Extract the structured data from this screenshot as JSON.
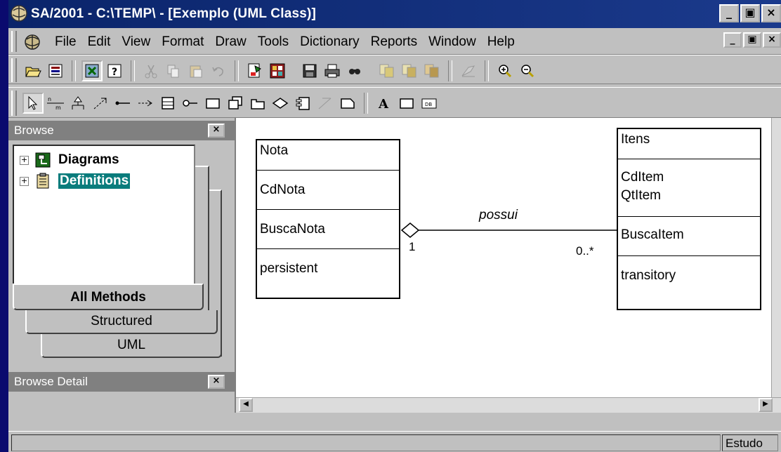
{
  "window": {
    "title": "SA/2001 - C:\\TEMP\\ - [Exemplo (UML Class)]",
    "buttons": {
      "minimize": "_",
      "restore": "▣",
      "close": "×"
    }
  },
  "menu": [
    "File",
    "Edit",
    "View",
    "Format",
    "Draw",
    "Tools",
    "Dictionary",
    "Reports",
    "Window",
    "Help"
  ],
  "browse": {
    "title": "Browse",
    "close": "×",
    "tree": [
      {
        "label": "Diagrams",
        "expander": "+",
        "icon": "diagram-icon"
      },
      {
        "label": "Definitions",
        "expander": "+",
        "icon": "definitions-icon",
        "selected": true
      }
    ],
    "tabs": [
      "All Methods",
      "Structured",
      "UML"
    ]
  },
  "browse_detail": {
    "title": "Browse Detail",
    "close": "×"
  },
  "diagram": {
    "classes": [
      {
        "name": "Nota",
        "attributes": [
          "CdNota"
        ],
        "operations": [
          "BuscaNota"
        ],
        "stereotype": [
          "persistent"
        ]
      },
      {
        "name": "Itens",
        "attributes": [
          "CdItem",
          "QtItem"
        ],
        "operations": [
          "BuscaItem"
        ],
        "stereotype": [
          "transitory"
        ]
      }
    ],
    "association": {
      "name": "possui",
      "source_multiplicity": "1",
      "target_multiplicity": "0..*",
      "kind": "aggregation"
    }
  },
  "status": {
    "right": "Estudo"
  },
  "colors": {
    "titlebar": "#0a246a",
    "face": "#c0c0c0",
    "selection": "#0a7c7c",
    "desktop": "#0a0a6e"
  }
}
